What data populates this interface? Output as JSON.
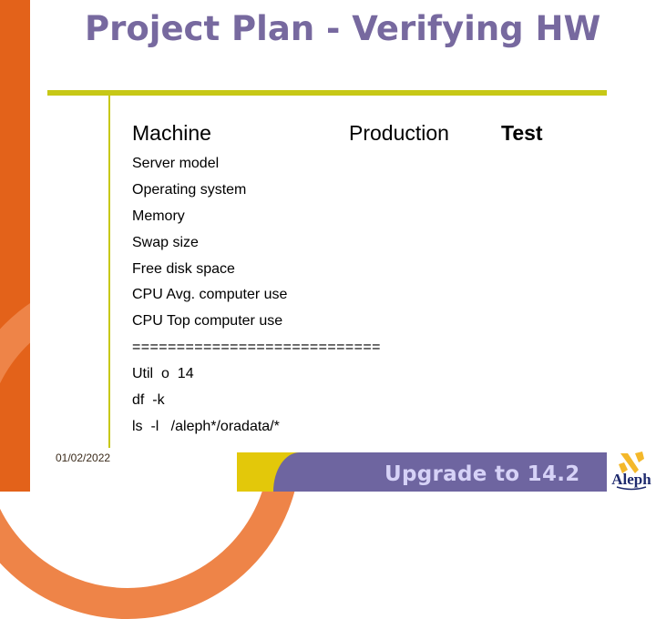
{
  "slide": {
    "title": "Project Plan - Verifying HW",
    "columns": {
      "machine": "Machine",
      "production": "Production",
      "test": "Test"
    },
    "items": [
      "Server model",
      "Operating system",
      "Memory",
      "Swap size",
      "Free disk space",
      "CPU Avg. computer use",
      "CPU Top computer use",
      "============================",
      "Util  o  14",
      "df  -k",
      "ls  -l   /aleph*/oradata/*"
    ]
  },
  "footer": {
    "date": "01/02/2022",
    "title": "Upgrade to 14.2",
    "logo_text": "Aleph"
  },
  "colors": {
    "orange": "#e3621a",
    "light_orange": "#ee8448",
    "yellow": "#e3c80a",
    "purple": "#6e65a0",
    "title_purple": "#77699f",
    "rule_green": "#c7c816",
    "footer_text": "#d6d2f7"
  }
}
